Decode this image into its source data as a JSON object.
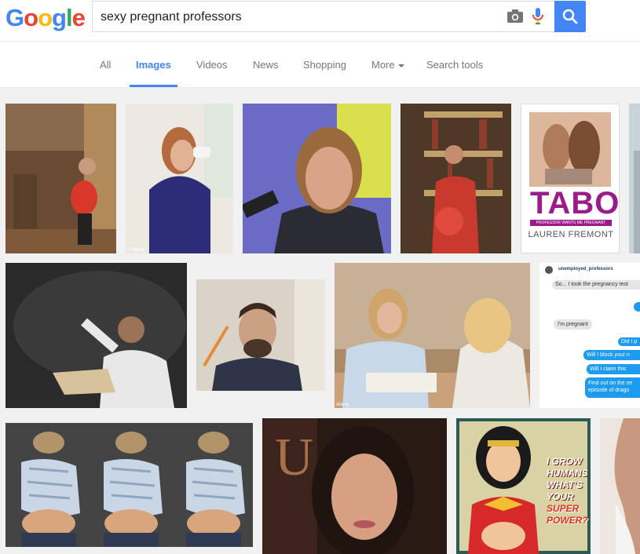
{
  "logo": {
    "letters": [
      "G",
      "o",
      "o",
      "g",
      "l",
      "e"
    ]
  },
  "search": {
    "query": "sexy pregnant professors"
  },
  "tabs": [
    {
      "label": "All",
      "active": false
    },
    {
      "label": "Images",
      "active": true
    },
    {
      "label": "Videos",
      "active": false
    },
    {
      "label": "News",
      "active": false
    },
    {
      "label": "Shopping",
      "active": false
    },
    {
      "label": "More",
      "active": false
    },
    {
      "label": "Search tools",
      "active": false
    }
  ],
  "icons": [
    "camera-icon",
    "mic-icon",
    "search-icon"
  ],
  "colors": {
    "accent": "#4285f4",
    "background": "#f1f1f1"
  },
  "results": {
    "book_cover": {
      "title": "TABOO",
      "subtitle": "PROFESSOR WANTS ME PREGNANT",
      "author": "LAUREN FREMONT"
    },
    "alamy_tag": "© Alamy",
    "alamy_tag_2": "Alamy",
    "chat": {
      "username": "unemployed_professors",
      "messages": [
        "So... I took the pregnancy test",
        "Did I p",
        "I'm pregnant",
        "Will I block your n",
        "Will I claim this",
        "Find out on the ne episode of drago"
      ]
    },
    "comic_text": [
      "I GROW",
      "HUMANS",
      "WHAT'S",
      "YOUR",
      "SUPER",
      "POWER?"
    ],
    "banner_letter": "U"
  }
}
